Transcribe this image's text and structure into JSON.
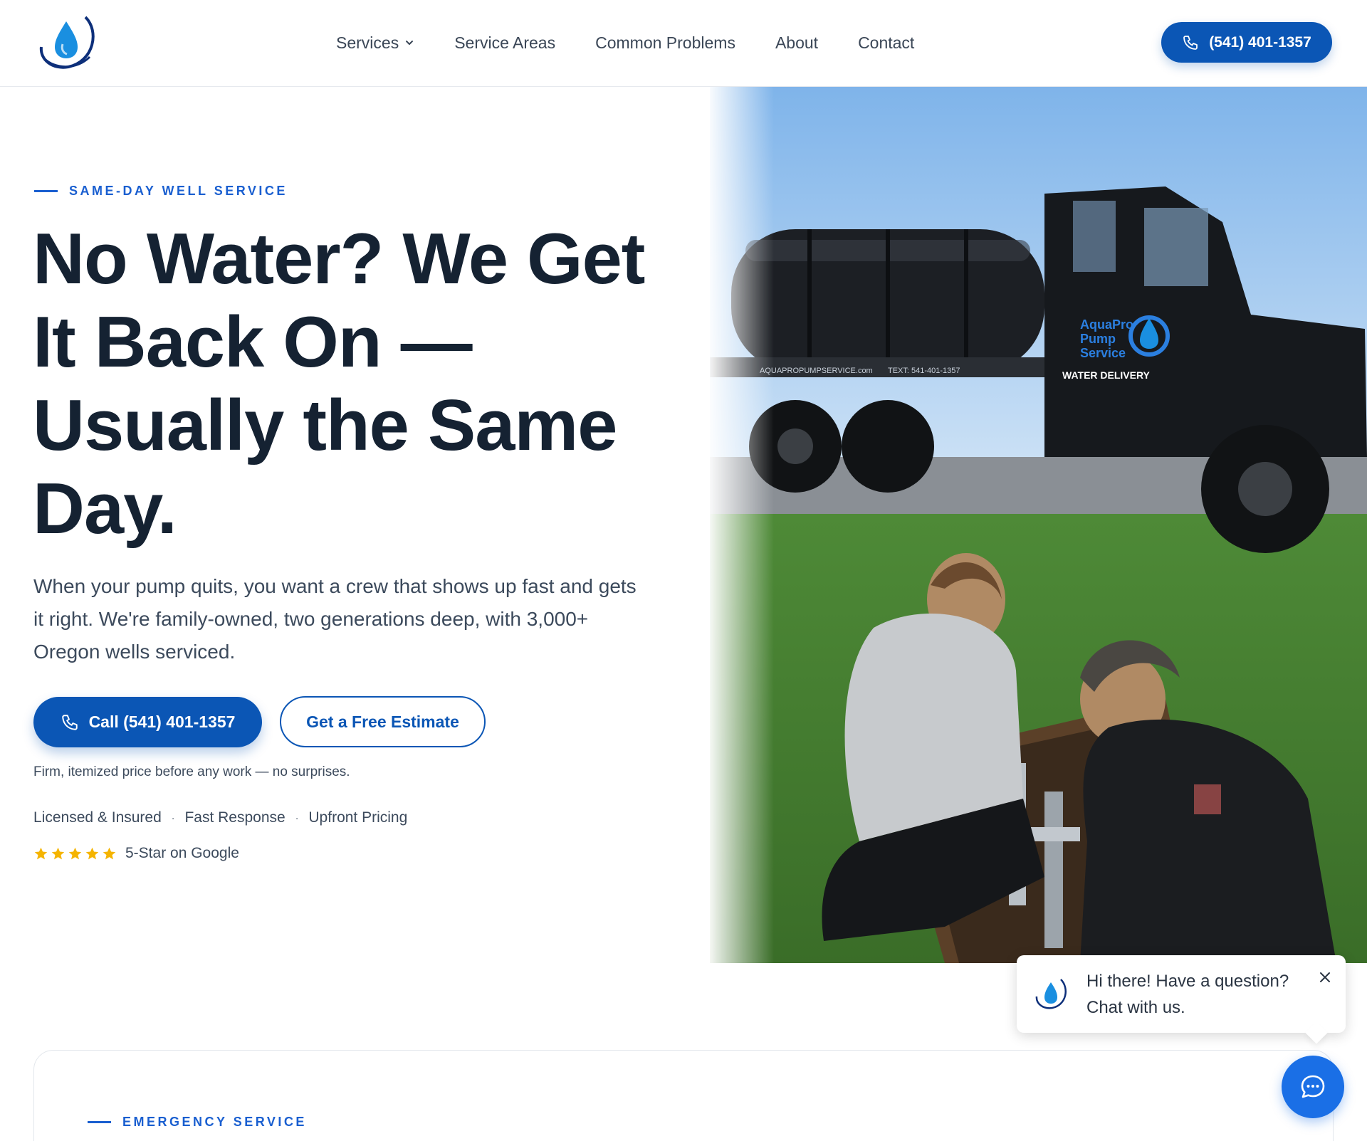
{
  "brand": {
    "logo_text": "Aqua Pro Pump Service",
    "accent": "#0b56b5",
    "eyebrow_color": "#1a5fd0",
    "star_color": "#f5b400"
  },
  "nav": {
    "items": [
      {
        "label": "Services",
        "has_dropdown": true,
        "icon": "chevron-down-icon"
      },
      {
        "label": "Service Areas"
      },
      {
        "label": "Common Problems"
      },
      {
        "label": "About"
      },
      {
        "label": "Contact"
      }
    ],
    "phone_label": "(541) 401-1357",
    "phone_icon": "phone-icon"
  },
  "hero": {
    "eyebrow": "SAME-DAY WELL SERVICE",
    "headline_lines": [
      "No Water? We Get",
      "It Back On —",
      "Usually the Same",
      "Day."
    ],
    "lead": "When your pump quits, you want a crew that shows up fast and gets it right. We're family-owned, two generations deep, with 3,000+ Oregon wells serviced.",
    "cta_call": "Call (541) 401-1357",
    "cta_estimate": "Get a Free Estimate",
    "price_note": "Firm, itemized price before any work — no surprises.",
    "trust": [
      "Licensed & Insured",
      "Fast Response",
      "Upfront Pricing"
    ],
    "trust_separator": "·",
    "rating_stars": 5,
    "rating_text": "5-Star on Google",
    "image": {
      "truck_lines": [
        "AquaPro",
        "Pump",
        "Service"
      ],
      "truck_tag": "WATER DELIVERY",
      "truck_site": "AQUAPROPUMPSERVICE.com",
      "truck_phone": "TEXT: 541-401-1357"
    }
  },
  "emergency": {
    "eyebrow": "EMERGENCY SERVICE"
  },
  "chat": {
    "greeting_line1": "Hi there! Have a question?",
    "greeting_line2": "Chat with us.",
    "fab_icon": "chat-bubble-icon"
  }
}
